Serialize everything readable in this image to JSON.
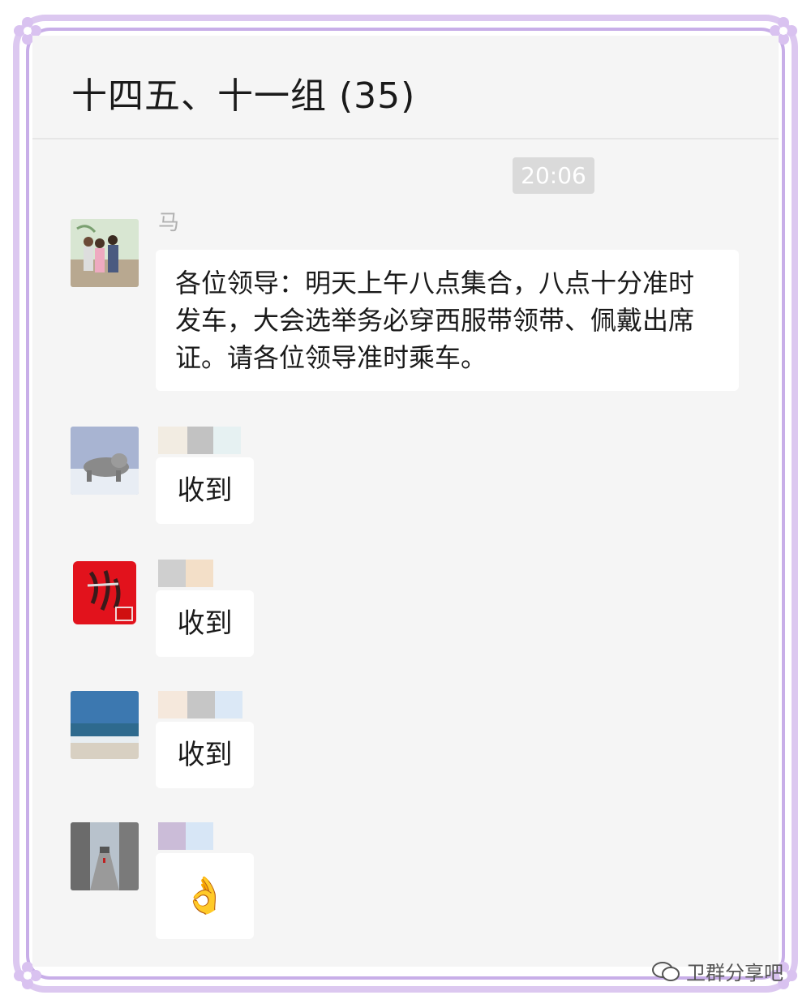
{
  "chat": {
    "title": "十四五、十一组 (35)",
    "timestamp": "20:06"
  },
  "messages": [
    {
      "sender": "马",
      "text": "各位领导：明天上午八点集合，八点十分准时发车，大会选举务必穿西服带领带、佩戴出席证。请各位领导准时乘车。"
    },
    {
      "sender": "",
      "text": "收到"
    },
    {
      "sender": "",
      "text": "收到"
    },
    {
      "sender": "",
      "text": "收到"
    },
    {
      "sender": "",
      "text": "👌"
    }
  ],
  "watermark": {
    "label": "卫群分享吧"
  },
  "colors": {
    "frame": "#dcc8f0",
    "chat_bg": "#f5f5f5",
    "bubble": "#ffffff"
  }
}
